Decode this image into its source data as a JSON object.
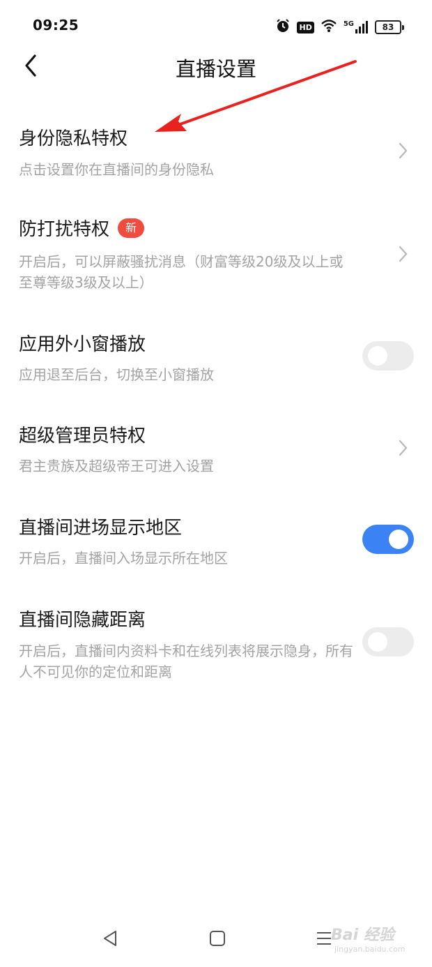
{
  "status_bar": {
    "time": "09:25",
    "hd_label": "HD",
    "network_label": "5G",
    "battery": "83",
    "icons": [
      "alarm-icon",
      "hd-icon",
      "wifi-icon",
      "signal-5g-icon",
      "battery-icon"
    ]
  },
  "header": {
    "title": "直播设置",
    "back_icon": "chevron-left-icon"
  },
  "settings": [
    {
      "title": "身份隐私特权",
      "desc": "点击设置你在直播间的身份隐私",
      "control": "chevron"
    },
    {
      "title": "防打扰特权",
      "badge": "新",
      "desc": "开启后，可以屏蔽骚扰消息（财富等级20级及以上或至尊等级3级及以上）",
      "control": "chevron"
    },
    {
      "title": "应用外小窗播放",
      "desc": "应用退至后台，切换至小窗播放",
      "control": "toggle",
      "on": false
    },
    {
      "title": "超级管理员特权",
      "desc": "君主贵族及超级帝王可进入设置",
      "control": "chevron"
    },
    {
      "title": "直播间进场显示地区",
      "desc": "开启后，直播间入场显示所在地区",
      "control": "toggle",
      "on": true
    },
    {
      "title": "直播间隐藏距离",
      "desc": "开启后，直播间内资料卡和在线列表将展示隐身，所有人不可见你的定位和距离",
      "control": "toggle",
      "on": false
    }
  ],
  "bottom_nav": {
    "icons": [
      "nav-back-icon",
      "nav-home-icon",
      "nav-menu-icon"
    ]
  },
  "watermark": {
    "text": "Bai 经验",
    "sub": "jingyan.baidu.com"
  },
  "colors": {
    "toggle_on": "#3b83f4",
    "toggle_off": "#ececec",
    "badge": "#ef4b3e",
    "annotation_arrow": "#e8231f"
  }
}
